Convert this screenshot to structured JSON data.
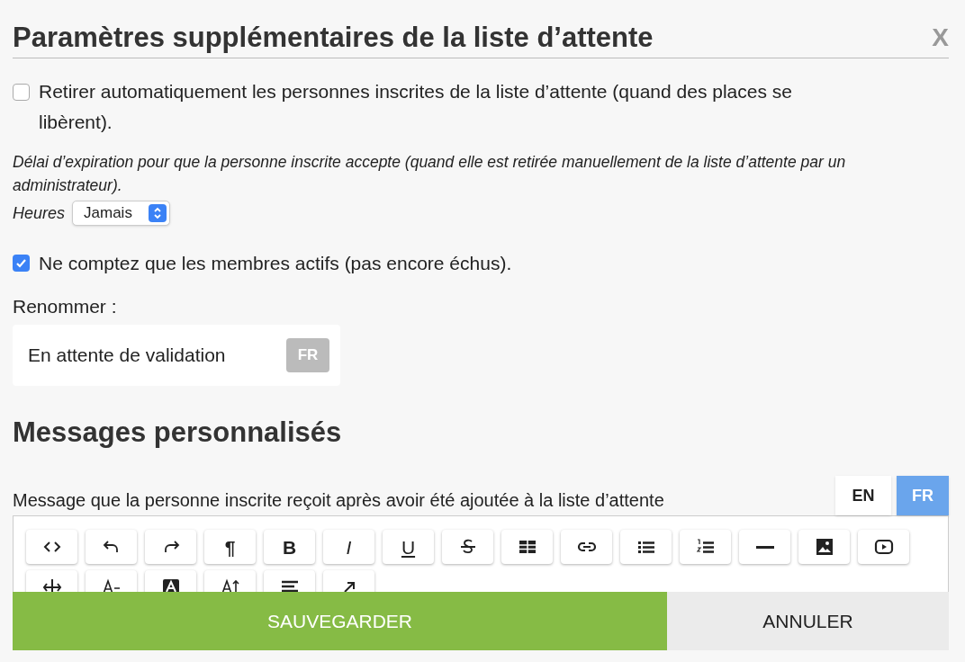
{
  "title": "Paramètres supplémentaires de la liste d’attente",
  "close": "X",
  "auto_remove": {
    "label": "Retirer automatiquement les personnes inscrites de la liste d’attente (quand des places se libèrent).",
    "checked": false
  },
  "expiry": {
    "note": "Délai d’expiration pour que la personne inscrite accepte (quand elle est retirée manuellement de la liste d’attente par un administrateur).",
    "unit": "Heures",
    "value": "Jamais"
  },
  "active_only": {
    "label": "Ne comptez que les membres actifs (pas encore échus).",
    "checked": true
  },
  "rename": {
    "label": "Renommer :",
    "value": "En attente de validation",
    "lang": "FR"
  },
  "messages": {
    "heading": "Messages personnalisés",
    "label": "Message que la personne inscrite reçoit après avoir été ajoutée à la liste d’attente",
    "langs": [
      {
        "label": "EN",
        "selected": false
      },
      {
        "label": "FR",
        "selected": true
      }
    ],
    "toolbar": [
      {
        "kind": "code"
      },
      {
        "kind": "undo"
      },
      {
        "kind": "redo"
      },
      {
        "kind": "pilcrow",
        "label": "¶"
      },
      {
        "kind": "bold",
        "label": "B"
      },
      {
        "kind": "italic",
        "label": "I"
      },
      {
        "kind": "underline",
        "label": "U"
      },
      {
        "kind": "strike"
      },
      {
        "kind": "table"
      },
      {
        "kind": "link"
      },
      {
        "kind": "bullets"
      },
      {
        "kind": "numbers"
      },
      {
        "kind": "rule"
      },
      {
        "kind": "image"
      },
      {
        "kind": "video"
      },
      {
        "kind": "direction"
      },
      {
        "kind": "fontsize"
      },
      {
        "kind": "color"
      },
      {
        "kind": "lineheight"
      },
      {
        "kind": "align"
      },
      {
        "kind": "expand"
      }
    ]
  },
  "buttons": {
    "save": "SAUVEGARDER",
    "cancel": "ANNULER"
  }
}
